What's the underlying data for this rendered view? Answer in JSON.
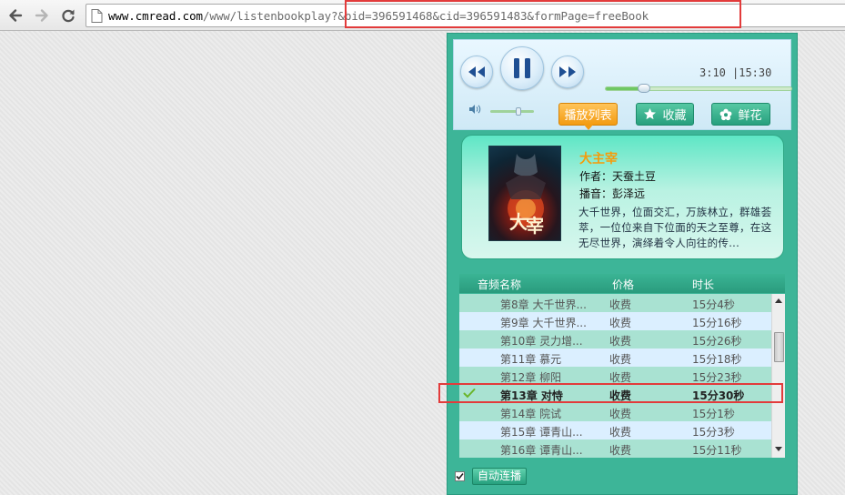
{
  "browser": {
    "url_host": "www.cmread.com",
    "url_path": "/www/listenbookplay?&bid=396591468&cid=396591483&formPage=freeBook"
  },
  "player": {
    "current_time": "3:10",
    "total_time": "|15:30",
    "progress": 0.2043,
    "volume": 0.65,
    "tabs": {
      "playlist": "播放列表",
      "favorite": "收藏",
      "flowers": "鲜花"
    },
    "book": {
      "title": "大主宰",
      "author": "作者：天蚕土豆",
      "narrator": "播音：彭泽远",
      "description": "大千世界，位面交汇，万族林立，群雄荟萃，一位位来自下位面的天之至尊，在这无尽世界，演绎着令人向往的传..."
    },
    "list": {
      "headers": {
        "name": "音频名称",
        "price": "价格",
        "duration": "时长"
      },
      "rows": [
        {
          "name": "第8章  大千世界...",
          "price": "收费",
          "duration": "15分4秒"
        },
        {
          "name": "第9章  大千世界...",
          "price": "收费",
          "duration": "15分16秒"
        },
        {
          "name": "第10章  灵力增...",
          "price": "收费",
          "duration": "15分26秒"
        },
        {
          "name": "第11章  慕元",
          "price": "收费",
          "duration": "15分18秒"
        },
        {
          "name": "第12章  柳阳",
          "price": "收费",
          "duration": "15分23秒"
        },
        {
          "name": "第13章  对恃",
          "price": "收费",
          "duration": "15分30秒"
        },
        {
          "name": "第14章  院试",
          "price": "收费",
          "duration": "15分1秒"
        },
        {
          "name": "第15章  谭青山...",
          "price": "收费",
          "duration": "15分3秒"
        },
        {
          "name": "第16章  谭青山...",
          "price": "收费",
          "duration": "15分11秒"
        }
      ]
    },
    "autoplay_label": "自动连播"
  },
  "colors": {
    "accent_orange": "#f39b12",
    "panel_green": "#3db598",
    "highlight_red": "#e23b3b"
  }
}
